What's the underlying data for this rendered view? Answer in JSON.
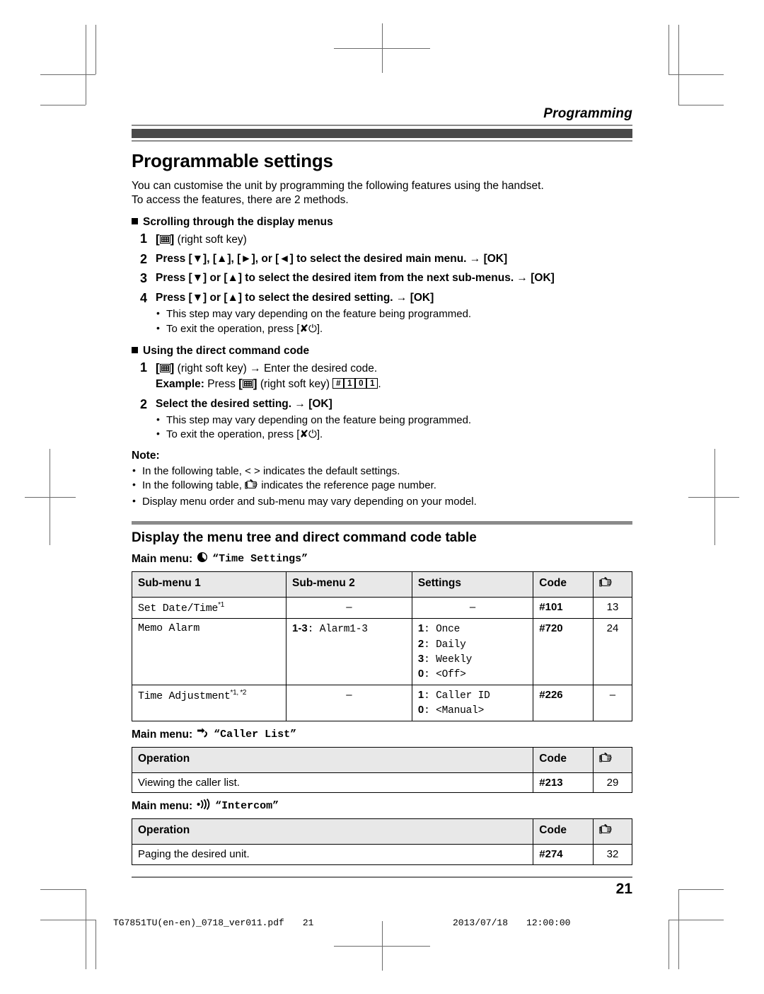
{
  "running_head": "Programming",
  "title": "Programmable settings",
  "intro": [
    "You can customise the unit by programming the following features using the handset.",
    "To access the features, there are 2 methods."
  ],
  "section_scrolling": {
    "heading": "Scrolling through the display menus",
    "steps": [
      {
        "num": "1",
        "pre": "",
        "softkey": true,
        "post": "(right soft key)"
      },
      {
        "num": "2",
        "text": "Press [▼], [▲], [►], or [◄] to select the desired main menu. → [OK]"
      },
      {
        "num": "3",
        "text": "Press [▼] or [▲] to select the desired item from the next sub-menus. → [OK]"
      },
      {
        "num": "4",
        "text": "Press [▼] or [▲] to select the desired setting. → [OK]"
      }
    ],
    "bullets": [
      "This step may vary depending on the feature being programmed.",
      "To exit the operation, press [✘⏻]."
    ]
  },
  "section_direct": {
    "heading": "Using the direct command code",
    "step1_post": "(right soft key) → Enter the desired code.",
    "example_label": "Example:",
    "example_pre": "Press",
    "example_mid": "(right soft key)",
    "example_keys": [
      "#",
      "1",
      "0",
      "1"
    ],
    "example_end": ".",
    "step2_num": "2",
    "step2_text": "Select the desired setting. → [OK]",
    "bullets": [
      "This step may vary depending on the feature being programmed.",
      "To exit the operation, press [✘⏻]."
    ]
  },
  "note": {
    "label": "Note:",
    "items": [
      "In the following table, < > indicates the default settings.",
      "In the following table, ☞ indicates the reference page number.",
      "Display menu order and sub-menu may vary depending on your model."
    ],
    "item2_pre": "In the following table,",
    "item2_post": "indicates the reference page number."
  },
  "subtitle": "Display the menu tree and direct command code table",
  "menus": [
    {
      "label": "Main menu:",
      "icon": "clock-icon",
      "name": "Time Settings",
      "columns": [
        "Sub-menu 1",
        "Sub-menu 2",
        "Settings",
        "Code",
        "☞"
      ],
      "rows": [
        {
          "sub1": "Set Date/Time",
          "sub1_sup": "*1",
          "sub2": "–",
          "settings": [
            "–"
          ],
          "code": "#101",
          "page": "13"
        },
        {
          "sub1": "Memo Alarm",
          "sub1_sup": "",
          "sub2_num": "1-3",
          "sub2": "Alarm1-3",
          "settings_list": [
            {
              "n": "1",
              "v": "Once"
            },
            {
              "n": "2",
              "v": "Daily"
            },
            {
              "n": "3",
              "v": "Weekly"
            },
            {
              "n": "0",
              "v": "<Off>"
            }
          ],
          "code": "#720",
          "page": "24"
        },
        {
          "sub1": "Time Adjustment",
          "sub1_sup": "*1, *2",
          "sub2": "–",
          "settings_list": [
            {
              "n": "1",
              "v": "Caller ID"
            },
            {
              "n": "0",
              "v": "<Manual>"
            }
          ],
          "code": "#226",
          "page": "–"
        }
      ]
    },
    {
      "label": "Main menu:",
      "icon": "incoming-call-icon",
      "name": "Caller List",
      "columns": [
        "Operation",
        "Code",
        "☞"
      ],
      "rows": [
        {
          "operation": "Viewing the caller list.",
          "code": "#213",
          "page": "29"
        }
      ]
    },
    {
      "label": "Main menu:",
      "icon": "intercom-icon",
      "name": "Intercom",
      "columns": [
        "Operation",
        "Code",
        "☞"
      ],
      "rows": [
        {
          "operation": "Paging the desired unit.",
          "code": "#274",
          "page": "32"
        }
      ]
    }
  ],
  "page_number": "21",
  "sheet": {
    "filename": "TG7851TU(en-en)_0718_ver011.pdf",
    "page": "21",
    "date": "2013/07/18",
    "time": "12:00:00"
  }
}
